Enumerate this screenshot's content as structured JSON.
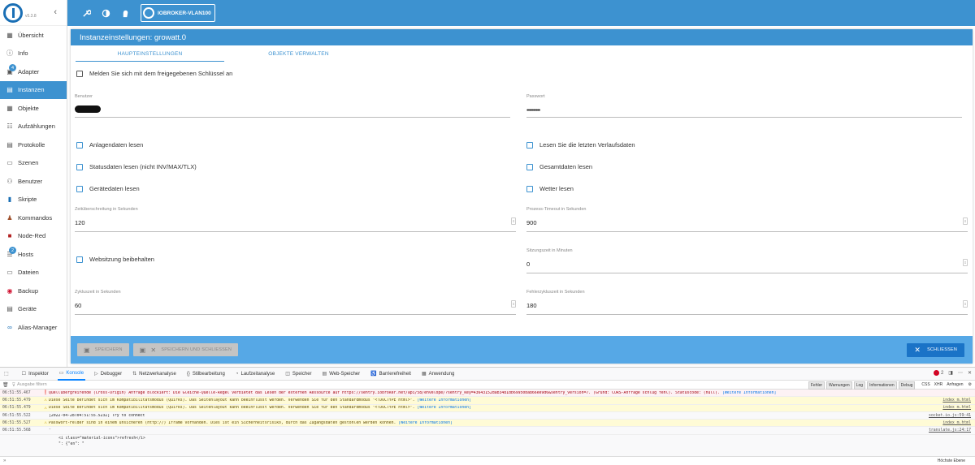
{
  "sidebar": {
    "version": "v5.3.8",
    "items": [
      {
        "label": "Übersicht",
        "icon": "grid-icon"
      },
      {
        "label": "Info",
        "icon": "info-icon"
      },
      {
        "label": "Adapter",
        "icon": "store-icon",
        "badge": "4"
      },
      {
        "label": "Instanzen",
        "icon": "instances-icon",
        "active": true
      },
      {
        "label": "Objekte",
        "icon": "list-icon"
      },
      {
        "label": "Aufzählungen",
        "icon": "enum-icon"
      },
      {
        "label": "Protokolle",
        "icon": "log-icon"
      },
      {
        "label": "Szenen",
        "icon": "scene-icon"
      },
      {
        "label": "Benutzer",
        "icon": "user-icon"
      },
      {
        "label": "Skripte",
        "icon": "script-icon"
      },
      {
        "label": "Kommandos",
        "icon": "commands-icon"
      },
      {
        "label": "Node-Red",
        "icon": "nodered-icon"
      },
      {
        "label": "Hosts",
        "icon": "hosts-icon",
        "badge": "2"
      },
      {
        "label": "Dateien",
        "icon": "files-icon"
      },
      {
        "label": "Backup",
        "icon": "backup-icon"
      },
      {
        "label": "Geräte",
        "icon": "devices-icon"
      },
      {
        "label": "Alias-Manager",
        "icon": "alias-icon"
      }
    ]
  },
  "topbar": {
    "host_label": "IOBROKER-VLAN100"
  },
  "panel": {
    "title": "Instanzeinstellungen: growatt.0",
    "tabs": [
      "HAUPTEINSTELLUNGEN",
      "OBJEKTE VERWALTEN"
    ],
    "share_key_label": "Melden Sie sich mit dem freigegebenen Schlüssel an",
    "user_label": "Benutzer",
    "password_label": "Passwort",
    "password_value": "••••••••••",
    "checkboxes": {
      "plant_data": "Anlagendaten lesen",
      "last_history": "Lesen Sie die letzten Verlaufsdaten",
      "status_data": "Statusdaten lesen (nicht INV/MAX/TLX)",
      "total_data": "Gesamtdaten lesen",
      "device_data": "Gerätedaten lesen",
      "weather": "Wetter lesen",
      "keep_session": "Websitzung beibehalten"
    },
    "fields": {
      "timeout_label": "Zeitüberschreitung in Sekunden",
      "timeout_value": "120",
      "process_label": "Prozess-Timeout in Sekunden",
      "process_value": "900",
      "session_label": "Sitzungszeit in Minuten",
      "session_value": "0",
      "cycle_label": "Zykluszeit in Sekunden",
      "cycle_value": "60",
      "error_cycle_label": "Fehlerzykluszeit in Sekunden",
      "error_cycle_value": "180"
    },
    "buttons": {
      "save": "SPEICHERN",
      "save_close": "SPEICHERN UND SCHLIESSEN",
      "close": "SCHLIESSEN"
    }
  },
  "devtools": {
    "tabs": [
      "Inspektor",
      "Konsole",
      "Debugger",
      "Netzwerkanalyse",
      "Stilbearbeitung",
      "Laufzeitanalyse",
      "Speicher",
      "Web-Speicher",
      "Barrierefreiheit",
      "Anwendung"
    ],
    "error_count": "2",
    "filter_placeholder": "Ausgabe filtern",
    "filters": [
      "Fehler",
      "Warnungen",
      "Log",
      "Informationen",
      "Debug"
    ],
    "filters_plain": [
      "CSS",
      "XHR",
      "Anfragen"
    ],
    "logs": [
      {
        "type": "err",
        "ts": "06:51:55.467",
        "msg": "Quellübergreifende (Cross-Origin) Anfrage blockiert: Die Gleiche-Quelle-Regel verbietet das Lesen der externen Ressource auf https://sentry.iobroker.net/api/58/envelope/?sentry_key=43643152dab3481db69950ba866ee9d6&sentry_version=7. (Grund: CORS-Anfrage schlug fehl). Statuscode: (null).",
        "link": "[Weitere Informationen]",
        "src": ""
      },
      {
        "type": "warn",
        "ts": "06:51:55.479",
        "msg": "Diese Seite befindet sich im Kompatibilitätsmodus (Quirks). Das Seitenlayout kann beeinflusst werden. Verwenden Sie für den Standardmodus \"<!DOCTYPE html>\".",
        "link": "[Weitere Informationen]",
        "src": "index_m.html"
      },
      {
        "type": "warn",
        "ts": "06:51:55.479",
        "msg": "Diese Seite befindet sich im Kompatibilitätsmodus (Quirks). Das Seitenlayout kann beeinflusst werden. Verwenden Sie für den Standardmodus \"<!DOCTYPE html>\".",
        "link": "[Weitere Informationen]",
        "src": "index_m.html"
      },
      {
        "type": "log",
        "ts": "06:51:55.522",
        "msg": "[2022-04-28T04:51:55.523Z] Try to connect",
        "link": "",
        "src": "socket.io.js:59:41"
      },
      {
        "type": "warn",
        "ts": "06:51:55.527",
        "msg": "Passwort-Felder sind in einem unsicheren (http://) Iframe vorhanden. Dies ist ein Sicherheitsrisiko, durch das Zugangsdaten gestohlen werden können.",
        "link": "[Weitere Informationen]",
        "src": "index_m.html"
      },
      {
        "type": "log",
        "ts": "06:51:55.568",
        "msg": "\"",
        "link": "",
        "src": "translate.js:24:17"
      }
    ],
    "object_line1": "<i class=\"material-icons\">refresh</i>",
    "object_line2": "\": {\"en\": \"",
    "bottom_right": "Höchste Ebene"
  }
}
